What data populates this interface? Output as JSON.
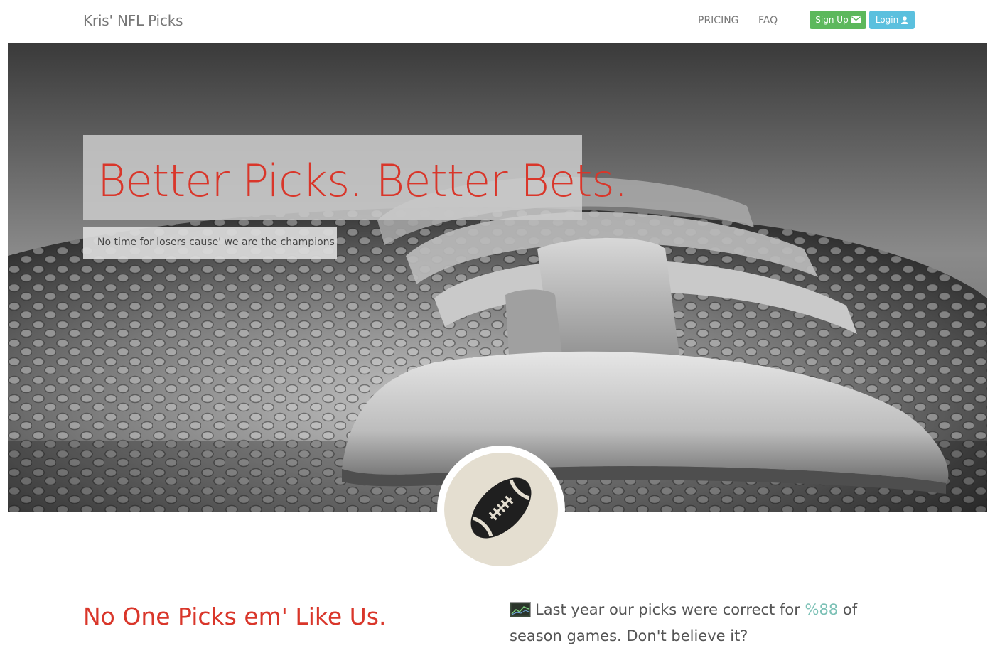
{
  "navbar": {
    "brand": "Kris' NFL Picks",
    "links": [
      {
        "label": "PRICING"
      },
      {
        "label": "FAQ"
      }
    ],
    "signup_label": "Sign Up",
    "login_label": "Login",
    "signup_icon": "envelope-icon",
    "login_icon": "user-icon"
  },
  "hero": {
    "headline": "Better Picks. Better Bets.",
    "subheadline": "No time for losers cause' we are the champions",
    "badge_icon": "football-icon"
  },
  "section": {
    "tagline": "No One Picks em' Like Us.",
    "stats_icon": "chart-icon",
    "stats_prefix": "Last year our picks were correct for",
    "stats_percent": "%88",
    "stats_suffix": "of season games. Don't believe it?"
  },
  "colors": {
    "accent_red": "#d9362a",
    "signup_green": "#5cb85c",
    "login_blue": "#5bc0de",
    "percent_teal": "#7cc1b6",
    "badge_bg": "#e4ded0"
  }
}
